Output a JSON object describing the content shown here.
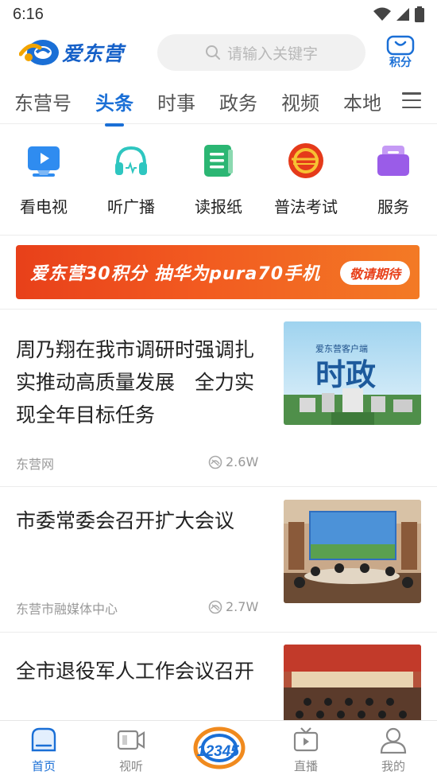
{
  "status_bar": {
    "time": "6:16"
  },
  "header": {
    "logo_text": "爱东营",
    "search_placeholder": "请输入关键字",
    "points_label": "积分"
  },
  "tabs": [
    {
      "label": "东营号",
      "active": false
    },
    {
      "label": "头条",
      "active": true
    },
    {
      "label": "时事",
      "active": false
    },
    {
      "label": "政务",
      "active": false
    },
    {
      "label": "视频",
      "active": false
    },
    {
      "label": "本地",
      "active": false
    }
  ],
  "shortcuts": [
    {
      "label": "看电视",
      "icon": "tv-play-icon"
    },
    {
      "label": "听广播",
      "icon": "headphones-icon"
    },
    {
      "label": "读报纸",
      "icon": "newspaper-icon"
    },
    {
      "label": "普法考试",
      "icon": "law-exam-badge-icon"
    },
    {
      "label": "服务",
      "icon": "service-folder-icon"
    }
  ],
  "banner": {
    "text": "爱东营30积分 抽华为pura70手机",
    "pill": "敬请期待"
  },
  "news": [
    {
      "title": "周乃翔在我市调研时强调扎实推动高质量发展　全力实现全年目标任务",
      "source": "东营网",
      "views": "2.6W",
      "thumb_caption_small": "爱东营客户端",
      "thumb_caption_big": "时政"
    },
    {
      "title": "市委常委会召开扩大会议",
      "source": "东营市融媒体中心",
      "views": "2.7W"
    },
    {
      "title": "全市退役军人工作会议召开"
    }
  ],
  "bottom_nav": [
    {
      "label": "首页",
      "icon": "home-icon",
      "active": true
    },
    {
      "label": "视听",
      "icon": "video-icon",
      "active": false
    },
    {
      "label": "12345",
      "icon": "hotline-12345-icon",
      "active": false
    },
    {
      "label": "直播",
      "icon": "live-tv-icon",
      "active": false
    },
    {
      "label": "我的",
      "icon": "profile-icon",
      "active": false
    }
  ],
  "colors": {
    "accent": "#1a6fd6",
    "banner": "#ee4a1c"
  }
}
